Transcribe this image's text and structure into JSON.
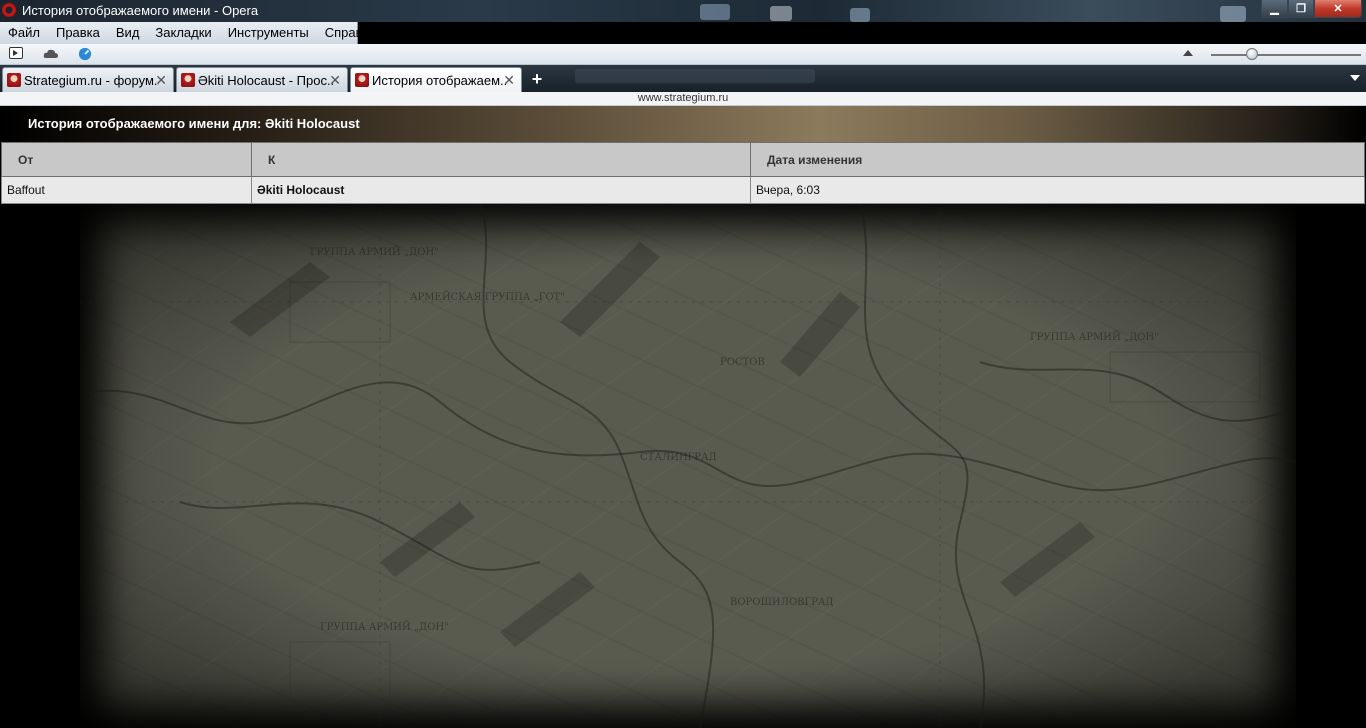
{
  "window": {
    "title": "История отображаемого имени - Opera",
    "controls": {
      "minimize": "▁",
      "maximize": "❐",
      "close": "✕"
    }
  },
  "menu": {
    "items": [
      {
        "label": "Файл"
      },
      {
        "label": "Правка"
      },
      {
        "label": "Вид"
      },
      {
        "label": "Закладки"
      },
      {
        "label": "Инструменты"
      },
      {
        "label": "Справка"
      }
    ]
  },
  "toolbar": {
    "icons": [
      "panel-toggle-icon",
      "opera-unite-cloud-icon",
      "opera-turbo-icon"
    ],
    "zoom_level": 0.27
  },
  "tabs": [
    {
      "label": "Strategium.ru - форум...",
      "active": false
    },
    {
      "label": "Əkiti Holocaust - Прос...",
      "active": false
    },
    {
      "label": "История отображаем...",
      "active": true
    }
  ],
  "address": {
    "url": "www.strategium.ru"
  },
  "page": {
    "heading": "История отображаемого имени для: Əkiti Holocaust",
    "table": {
      "headers": [
        "От",
        "К",
        "Дата изменения"
      ],
      "rows": [
        {
          "from": "Baffout",
          "to": "Əkiti Holocaust",
          "date": "Вчера, 6:03"
        }
      ]
    }
  },
  "colors": {
    "titlebar": "#1b2530",
    "tab_active": "#ffffff",
    "table_header": "#c8c8c8",
    "table_row": "#e9e9e9",
    "map_bg": "#5a5b4f"
  }
}
